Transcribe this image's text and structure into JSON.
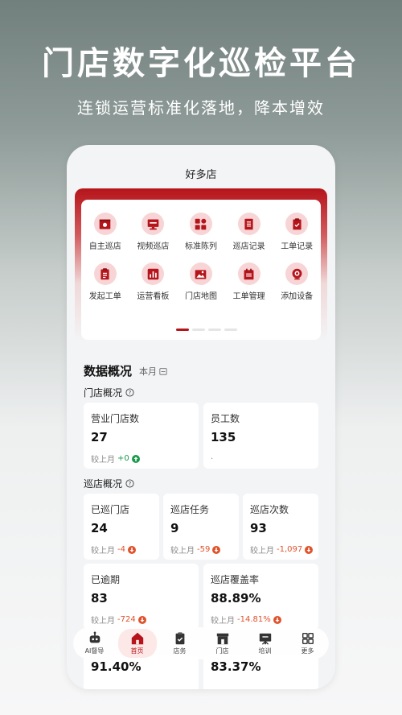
{
  "hero": {
    "title": "门店数字化巡检平台",
    "subtitle": "连锁运营标准化落地，降本增效"
  },
  "app": {
    "store_name": "好多店",
    "accent_color": "#b5141a",
    "menu": [
      {
        "label": "自主巡店",
        "icon": "store-camera-icon"
      },
      {
        "label": "视频巡店",
        "icon": "monitor-icon"
      },
      {
        "label": "标准陈列",
        "icon": "grid-icon"
      },
      {
        "label": "巡店记录",
        "icon": "document-icon"
      },
      {
        "label": "工单记录",
        "icon": "clipboard-icon"
      },
      {
        "label": "发起工单",
        "icon": "clipboard-list-icon"
      },
      {
        "label": "运营看板",
        "icon": "chart-icon"
      },
      {
        "label": "门店地图",
        "icon": "map-icon"
      },
      {
        "label": "工单管理",
        "icon": "calendar-icon"
      },
      {
        "label": "添加设备",
        "icon": "camera-device-icon"
      }
    ],
    "carousel": {
      "pages": 4,
      "active": 0
    }
  },
  "overview": {
    "title": "数据概况",
    "period": "本月",
    "store_section": "门店概况",
    "patrol_section": "巡店概况",
    "compare_prefix": "较上月",
    "store_cards": [
      {
        "label": "营业门店数",
        "value": "27",
        "delta": "+0",
        "direction": "up"
      },
      {
        "label": "员工数",
        "value": "135",
        "delta": ".",
        "direction": "none"
      }
    ],
    "patrol_cards": [
      {
        "label": "已巡门店",
        "value": "24",
        "delta": "-4",
        "direction": "down"
      },
      {
        "label": "巡店任务",
        "value": "9",
        "delta": "-59",
        "direction": "down"
      },
      {
        "label": "巡店次数",
        "value": "93",
        "delta": "-1,097",
        "direction": "down"
      }
    ],
    "extra_cards": [
      {
        "label": "已逾期",
        "value": "83",
        "delta": "-724",
        "direction": "down"
      },
      {
        "label": "巡店覆盖率",
        "value": "88.89%",
        "delta": "-14.81%",
        "direction": "down"
      }
    ],
    "peek_values": [
      "91.40%",
      "83.37%"
    ]
  },
  "tabbar": [
    {
      "label": "AI督导",
      "icon": "robot-icon"
    },
    {
      "label": "首页",
      "icon": "home-icon",
      "active": true
    },
    {
      "label": "店务",
      "icon": "task-icon"
    },
    {
      "label": "门店",
      "icon": "store-icon"
    },
    {
      "label": "培训",
      "icon": "training-icon"
    },
    {
      "label": "更多",
      "icon": "more-grid-icon"
    }
  ]
}
